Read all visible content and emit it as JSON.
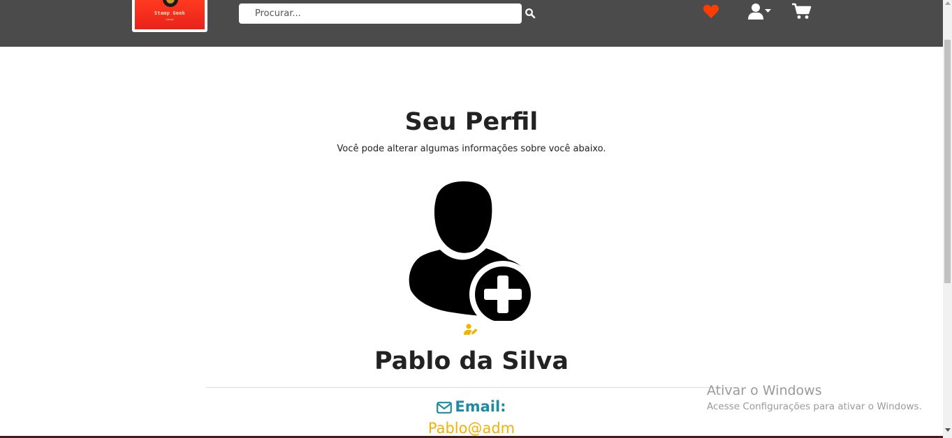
{
  "header": {
    "logo_text": "Stamp Geek",
    "logo_subtext": "ONLINE",
    "search_placeholder": "Procurar...",
    "search_icon": "search-icon",
    "icons": [
      "heart-icon",
      "user-dropdown-icon",
      "cart-icon"
    ],
    "colors": {
      "bar": "#4b4b4b",
      "heart": "#ff3d00"
    }
  },
  "profile": {
    "title": "Seu Perfil",
    "subtitle": "Você pode alterar algumas informações sobre você abaixo.",
    "avatar_icon": "add-user-icon",
    "edit_icon": "user-edit-icon",
    "name": "Pablo da Silva",
    "email_label": "Email:",
    "email_value": "Pablo@adm",
    "colors": {
      "email_label": "#1f8aa3",
      "email_value": "#f0b400"
    }
  },
  "watermark": {
    "title": "Ativar o Windows",
    "subtitle": "Acesse Configurações para ativar o Windows."
  }
}
